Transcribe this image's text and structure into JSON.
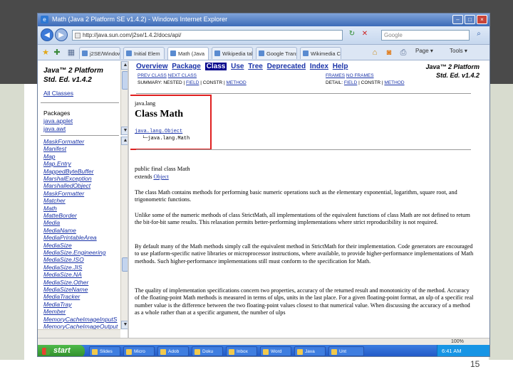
{
  "slide": {
    "page_number": "15"
  },
  "browser": {
    "title": "Math (Java 2 Platform SE v1.4.2) - Windows Internet Explorer",
    "url": "http://java.sun.com/j2se/1.4.2/docs/api/",
    "search_placeholder": "Google",
    "tabs": [
      "j2SE/Window",
      "Initial Elem",
      "Math (Java",
      "Wikipedia tal",
      "Google Trans",
      "Wikimedia Co"
    ],
    "commands": [
      "Page",
      "Tools"
    ],
    "status": "",
    "zoom": "100%"
  },
  "left_frame": {
    "title_line1": "Java™ 2 Platform",
    "title_line2": "Std. Ed. v1.4.2",
    "all_classes": "All Classes",
    "packages_label": "Packages",
    "packages": [
      "java.applet",
      "java.awt"
    ],
    "classes": [
      "MaskFormatter",
      "Manifest",
      "Map",
      "Map.Entry",
      "MappedByteBuffer",
      "MarshalException",
      "MarshalledObject",
      "MaskFormatter",
      "Matcher",
      "Math",
      "MatteBorder",
      "Media",
      "MediaName",
      "MediaPrintableArea",
      "MediaSize",
      "MediaSize.Engineering",
      "MediaSize.ISO",
      "MediaSize.JIS",
      "MediaSize.NA",
      "MediaSize.Other",
      "MediaSizeName",
      "MediaTracker",
      "MediaTray",
      "Member",
      "MemoryCacheImageInputS",
      "MemoryCacheImageOutput"
    ]
  },
  "main": {
    "nav": {
      "overview": "Overview",
      "package": "Package",
      "class": "Class",
      "use": "Use",
      "tree": "Tree",
      "deprecated": "Deprecated",
      "index": "Index",
      "help": "Help"
    },
    "platform_title_line1": "Java™ 2 Platform",
    "platform_title_line2": "Std. Ed. v1.4.2",
    "prev_class": "PREV CLASS",
    "next_class": "NEXT CLASS",
    "frames": "FRAMES",
    "no_frames": "NO FRAMES",
    "summary_label": "SUMMARY: NESTED |",
    "summary_field": "FIELD",
    "summary_sep1": "| CONSTR |",
    "summary_method": "METHOD",
    "detail_label": "DETAIL:",
    "detail_field": "FIELD",
    "detail_sep": "| CONSTR |",
    "detail_method": "METHOD",
    "package_name": "java.lang",
    "class_title": "Class Math",
    "hierarchy_parent": "java.lang.Object",
    "hierarchy_child": "└─java.lang.Math",
    "declaration": "public final class Math",
    "extends_label": "extends",
    "extends_class": "Object",
    "para1": "The class Math contains methods for performing basic numeric operations such as the elementary exponential, logarithm, square root, and trigonometric functions.",
    "para2": "Unlike some of the numeric methods of class StrictMath, all implementations of the equivalent functions of class Math are not defined to return the bit-for-bit same results. This relaxation permits better-performing implementations where strict reproducibility is not required.",
    "para3": "By default many of the Math methods simply call the equivalent method in StrictMath for their implementation. Code generators are encouraged to use platform-specific native libraries or microprocessor instructions, where available, to provide higher-performance implementations of Math methods. Such higher-performance implementations still must conform to the specification for Math.",
    "para4": "The quality of implementation specifications concern two properties, accuracy of the returned result and monotonicity of the method. Accuracy of the floating-point Math methods is measured in terms of ulps, units in the last place. For a given floating-point format, an ulp of a specific real number value is the difference between the two floating-point values closest to that numerical value. When discussing the accuracy of a method as a whole rather than at a specific argument, the number of ulps"
  },
  "taskbar": {
    "start": "start",
    "tasks": [
      "Slides",
      "Micro",
      "Adob",
      "Doku",
      "Inbox",
      "Word",
      "Java",
      "Unt"
    ],
    "clock": "6:41 AM"
  },
  "colors": {
    "accent": "#00008b",
    "highlight_box": "#e02020",
    "link": "#1a33a8"
  }
}
